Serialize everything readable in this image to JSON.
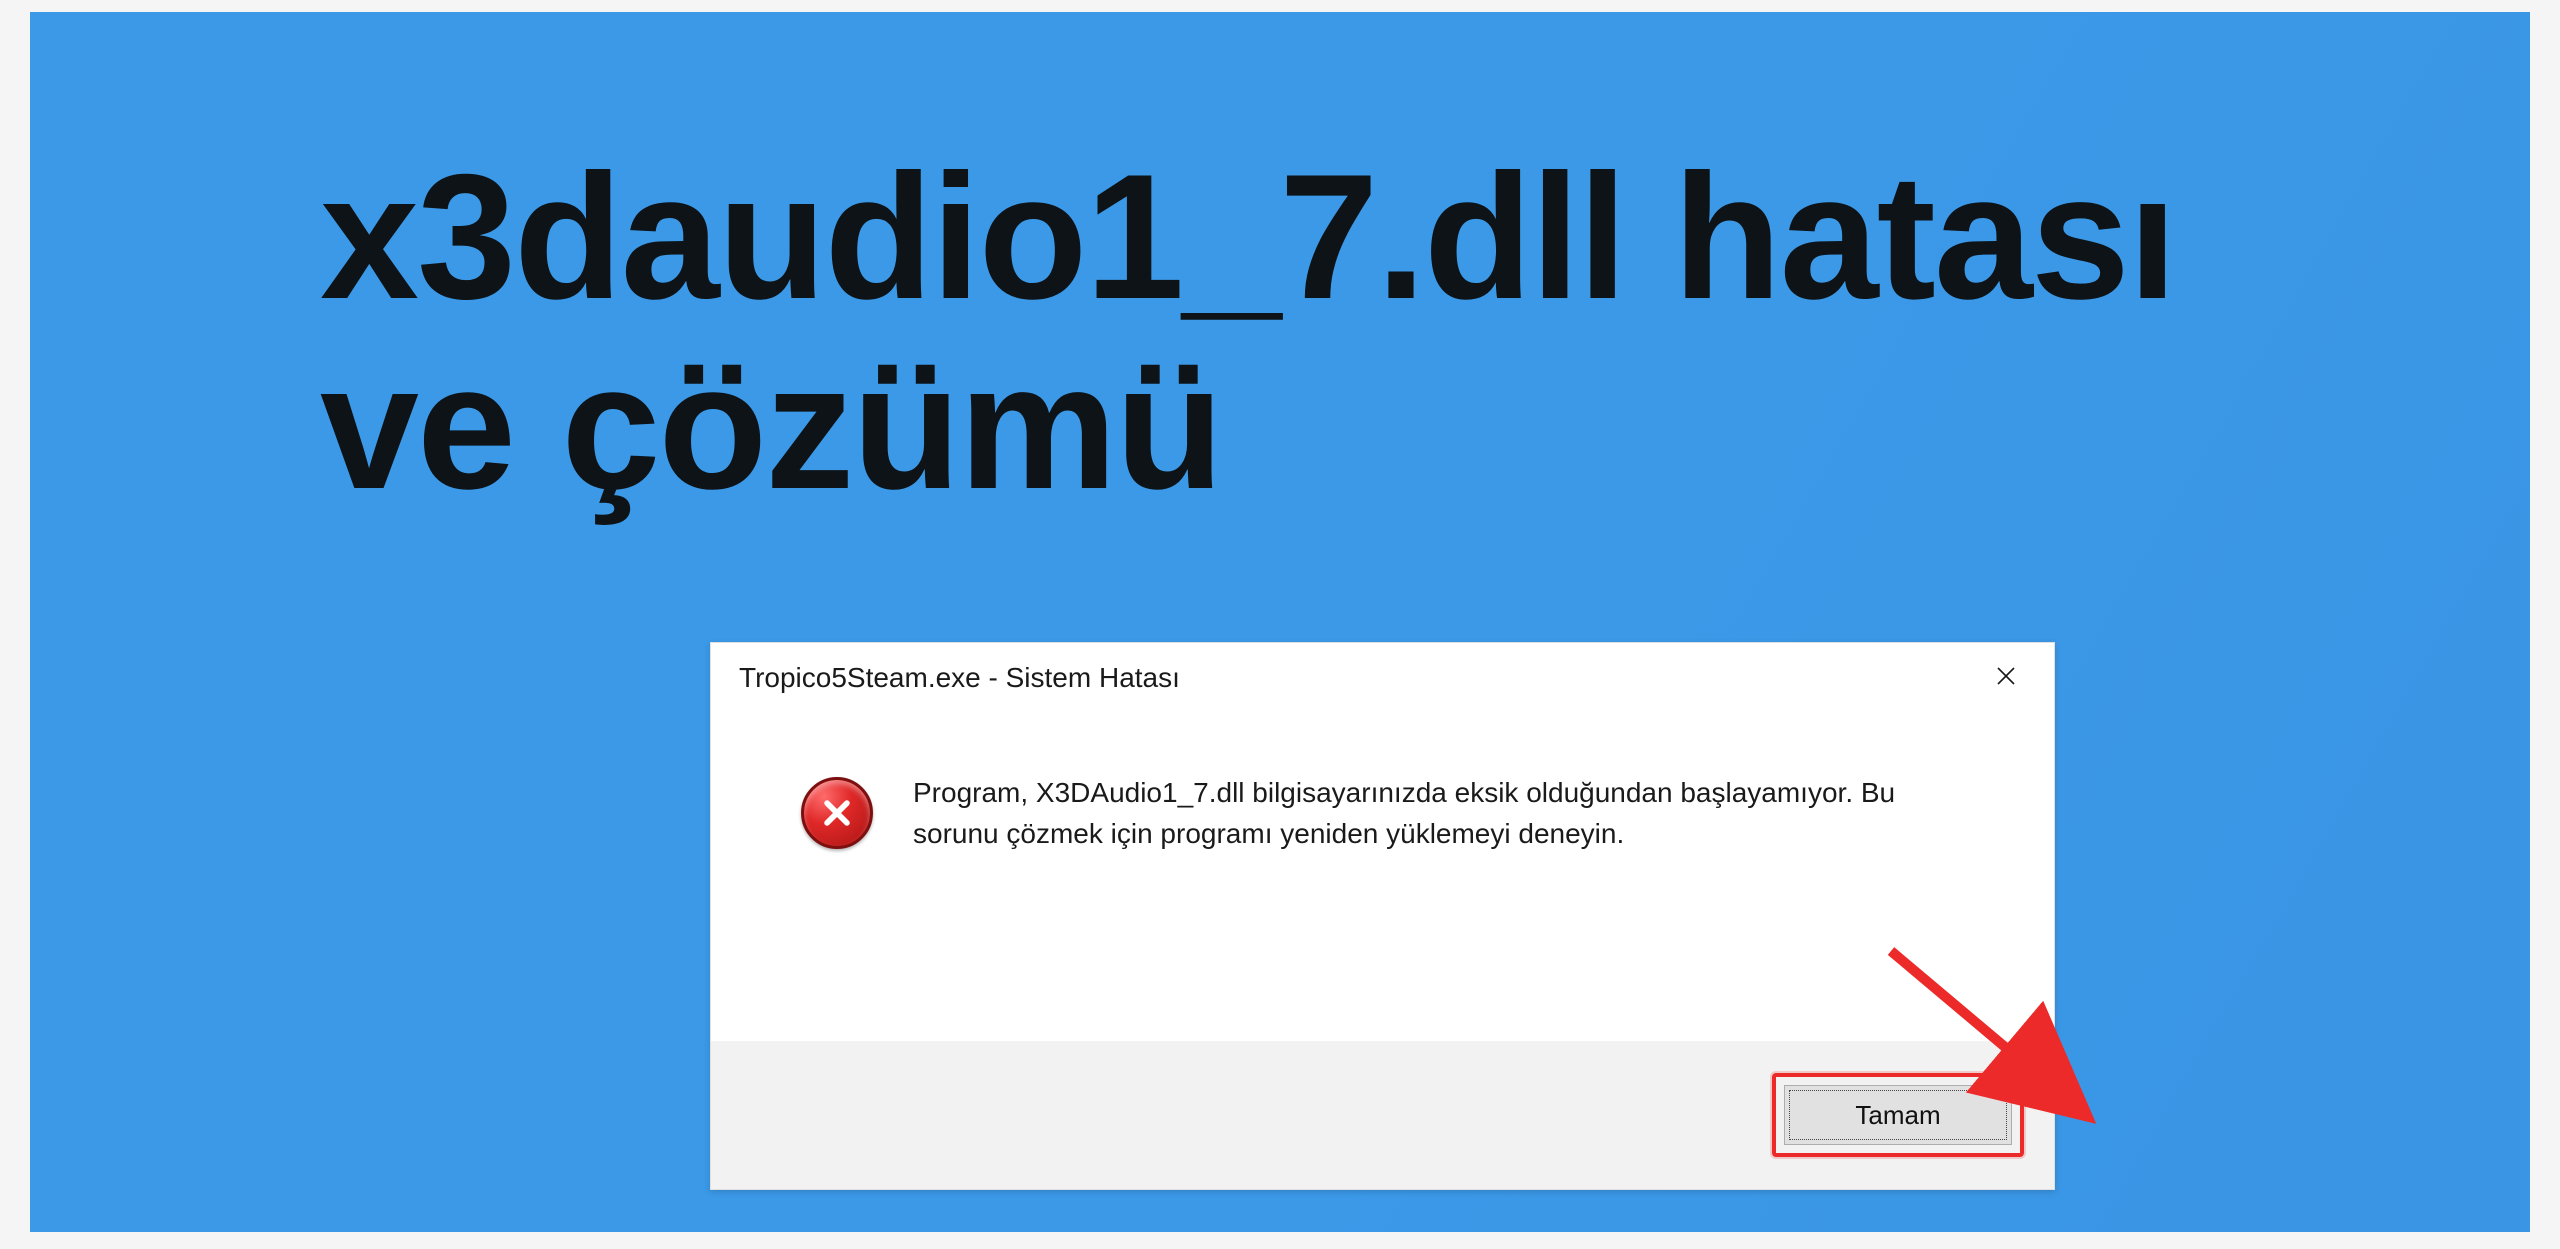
{
  "headline": "x3daudio1_7.dll hatası ve çözümü",
  "dialog": {
    "title": "Tropico5Steam.exe - Sistem Hatası",
    "message": "Program, X3DAudio1_7.dll bilgisayarınızda eksik olduğundan başlayamıyor. Bu sorunu çözmek için programı yeniden yüklemeyi deneyin.",
    "ok_label": "Tamam"
  },
  "colors": {
    "background": "#3b99e8",
    "highlight": "#ec2a2a"
  }
}
